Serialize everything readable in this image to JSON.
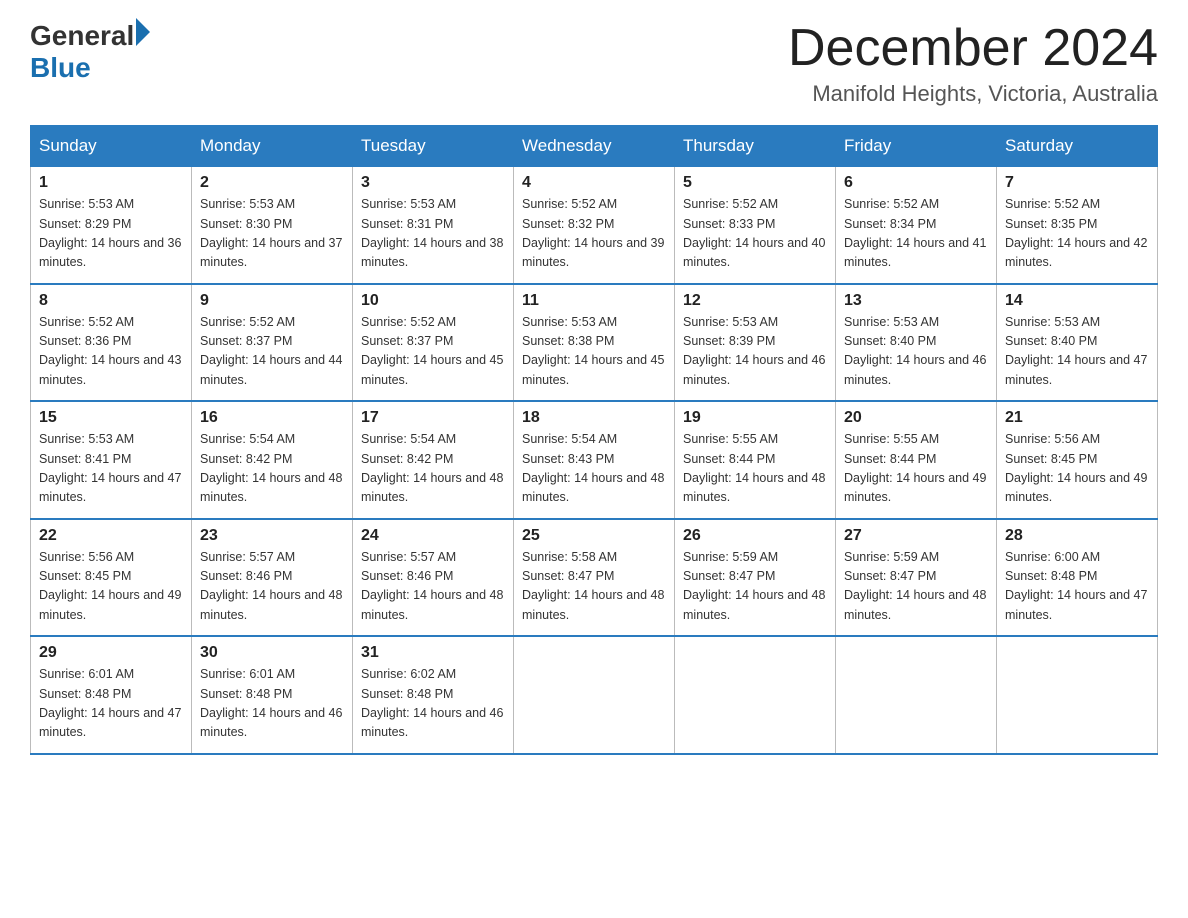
{
  "header": {
    "logo_general": "General",
    "logo_blue": "Blue",
    "month_title": "December 2024",
    "location": "Manifold Heights, Victoria, Australia"
  },
  "days_of_week": [
    "Sunday",
    "Monday",
    "Tuesday",
    "Wednesday",
    "Thursday",
    "Friday",
    "Saturday"
  ],
  "weeks": [
    [
      {
        "day": "1",
        "sunrise": "5:53 AM",
        "sunset": "8:29 PM",
        "daylight": "14 hours and 36 minutes."
      },
      {
        "day": "2",
        "sunrise": "5:53 AM",
        "sunset": "8:30 PM",
        "daylight": "14 hours and 37 minutes."
      },
      {
        "day": "3",
        "sunrise": "5:53 AM",
        "sunset": "8:31 PM",
        "daylight": "14 hours and 38 minutes."
      },
      {
        "day": "4",
        "sunrise": "5:52 AM",
        "sunset": "8:32 PM",
        "daylight": "14 hours and 39 minutes."
      },
      {
        "day": "5",
        "sunrise": "5:52 AM",
        "sunset": "8:33 PM",
        "daylight": "14 hours and 40 minutes."
      },
      {
        "day": "6",
        "sunrise": "5:52 AM",
        "sunset": "8:34 PM",
        "daylight": "14 hours and 41 minutes."
      },
      {
        "day": "7",
        "sunrise": "5:52 AM",
        "sunset": "8:35 PM",
        "daylight": "14 hours and 42 minutes."
      }
    ],
    [
      {
        "day": "8",
        "sunrise": "5:52 AM",
        "sunset": "8:36 PM",
        "daylight": "14 hours and 43 minutes."
      },
      {
        "day": "9",
        "sunrise": "5:52 AM",
        "sunset": "8:37 PM",
        "daylight": "14 hours and 44 minutes."
      },
      {
        "day": "10",
        "sunrise": "5:52 AM",
        "sunset": "8:37 PM",
        "daylight": "14 hours and 45 minutes."
      },
      {
        "day": "11",
        "sunrise": "5:53 AM",
        "sunset": "8:38 PM",
        "daylight": "14 hours and 45 minutes."
      },
      {
        "day": "12",
        "sunrise": "5:53 AM",
        "sunset": "8:39 PM",
        "daylight": "14 hours and 46 minutes."
      },
      {
        "day": "13",
        "sunrise": "5:53 AM",
        "sunset": "8:40 PM",
        "daylight": "14 hours and 46 minutes."
      },
      {
        "day": "14",
        "sunrise": "5:53 AM",
        "sunset": "8:40 PM",
        "daylight": "14 hours and 47 minutes."
      }
    ],
    [
      {
        "day": "15",
        "sunrise": "5:53 AM",
        "sunset": "8:41 PM",
        "daylight": "14 hours and 47 minutes."
      },
      {
        "day": "16",
        "sunrise": "5:54 AM",
        "sunset": "8:42 PM",
        "daylight": "14 hours and 48 minutes."
      },
      {
        "day": "17",
        "sunrise": "5:54 AM",
        "sunset": "8:42 PM",
        "daylight": "14 hours and 48 minutes."
      },
      {
        "day": "18",
        "sunrise": "5:54 AM",
        "sunset": "8:43 PM",
        "daylight": "14 hours and 48 minutes."
      },
      {
        "day": "19",
        "sunrise": "5:55 AM",
        "sunset": "8:44 PM",
        "daylight": "14 hours and 48 minutes."
      },
      {
        "day": "20",
        "sunrise": "5:55 AM",
        "sunset": "8:44 PM",
        "daylight": "14 hours and 49 minutes."
      },
      {
        "day": "21",
        "sunrise": "5:56 AM",
        "sunset": "8:45 PM",
        "daylight": "14 hours and 49 minutes."
      }
    ],
    [
      {
        "day": "22",
        "sunrise": "5:56 AM",
        "sunset": "8:45 PM",
        "daylight": "14 hours and 49 minutes."
      },
      {
        "day": "23",
        "sunrise": "5:57 AM",
        "sunset": "8:46 PM",
        "daylight": "14 hours and 48 minutes."
      },
      {
        "day": "24",
        "sunrise": "5:57 AM",
        "sunset": "8:46 PM",
        "daylight": "14 hours and 48 minutes."
      },
      {
        "day": "25",
        "sunrise": "5:58 AM",
        "sunset": "8:47 PM",
        "daylight": "14 hours and 48 minutes."
      },
      {
        "day": "26",
        "sunrise": "5:59 AM",
        "sunset": "8:47 PM",
        "daylight": "14 hours and 48 minutes."
      },
      {
        "day": "27",
        "sunrise": "5:59 AM",
        "sunset": "8:47 PM",
        "daylight": "14 hours and 48 minutes."
      },
      {
        "day": "28",
        "sunrise": "6:00 AM",
        "sunset": "8:48 PM",
        "daylight": "14 hours and 47 minutes."
      }
    ],
    [
      {
        "day": "29",
        "sunrise": "6:01 AM",
        "sunset": "8:48 PM",
        "daylight": "14 hours and 47 minutes."
      },
      {
        "day": "30",
        "sunrise": "6:01 AM",
        "sunset": "8:48 PM",
        "daylight": "14 hours and 46 minutes."
      },
      {
        "day": "31",
        "sunrise": "6:02 AM",
        "sunset": "8:48 PM",
        "daylight": "14 hours and 46 minutes."
      },
      null,
      null,
      null,
      null
    ]
  ],
  "labels": {
    "sunrise": "Sunrise:",
    "sunset": "Sunset:",
    "daylight": "Daylight:"
  }
}
